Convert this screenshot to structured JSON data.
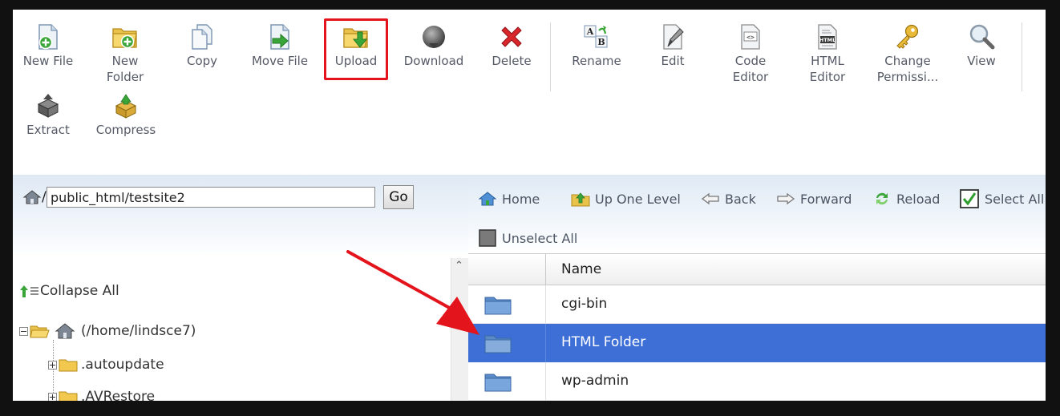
{
  "toolbar": {
    "row1": [
      {
        "name": "new-file-button",
        "label": "New File",
        "icon": "new-file-icon"
      },
      {
        "name": "new-folder-button",
        "label": "New\nFolder",
        "icon": "new-folder-icon"
      },
      {
        "name": "copy-button",
        "label": "Copy",
        "icon": "copy-icon"
      },
      {
        "name": "move-file-button",
        "label": "Move File",
        "icon": "move-file-icon"
      },
      {
        "name": "upload-button",
        "label": "Upload",
        "icon": "upload-icon"
      },
      {
        "name": "download-button",
        "label": "Download",
        "icon": "download-icon"
      },
      {
        "name": "delete-button",
        "label": "Delete",
        "icon": "delete-icon"
      },
      {
        "name": "rename-button",
        "label": "Rename",
        "icon": "rename-icon"
      },
      {
        "name": "edit-button",
        "label": "Edit",
        "icon": "edit-pencil-icon"
      },
      {
        "name": "code-editor-button",
        "label": "Code\nEditor",
        "icon": "code-editor-icon"
      },
      {
        "name": "html-editor-button",
        "label": "HTML\nEditor",
        "icon": "html-editor-icon"
      },
      {
        "name": "change-permissions-button",
        "label": "Change\nPermissi...",
        "icon": "key-icon"
      },
      {
        "name": "view-button",
        "label": "View",
        "icon": "magnifier-icon"
      }
    ],
    "row2": [
      {
        "name": "extract-button",
        "label": "Extract",
        "icon": "extract-icon"
      },
      {
        "name": "compress-button",
        "label": "Compress",
        "icon": "compress-icon"
      }
    ],
    "html_badge": "HTML",
    "code_badge": "<>",
    "rename_a": "A",
    "rename_b": "B"
  },
  "path_bar": {
    "prefix": "/",
    "path": "public_html/testsite2",
    "go_label": "Go"
  },
  "tree": {
    "collapse_all": "Collapse All",
    "root": "(/home/lindsce7)",
    "children": [
      ".autoupdate",
      ".AVRestore"
    ]
  },
  "nav": {
    "home": "Home",
    "up_one_level": "Up One Level",
    "back": "Back",
    "forward": "Forward",
    "reload": "Reload",
    "select_all": "Select All",
    "unselect_all": "Unselect All"
  },
  "grid": {
    "name_header": "Name",
    "rows": [
      {
        "name": "cgi-bin",
        "selected": false
      },
      {
        "name": "HTML Folder",
        "selected": true
      },
      {
        "name": "wp-admin",
        "selected": false
      }
    ]
  },
  "colors": {
    "selected_row": "#3d6fd6",
    "highlight_box": "#e3141b",
    "arrow": "#e3141b"
  }
}
